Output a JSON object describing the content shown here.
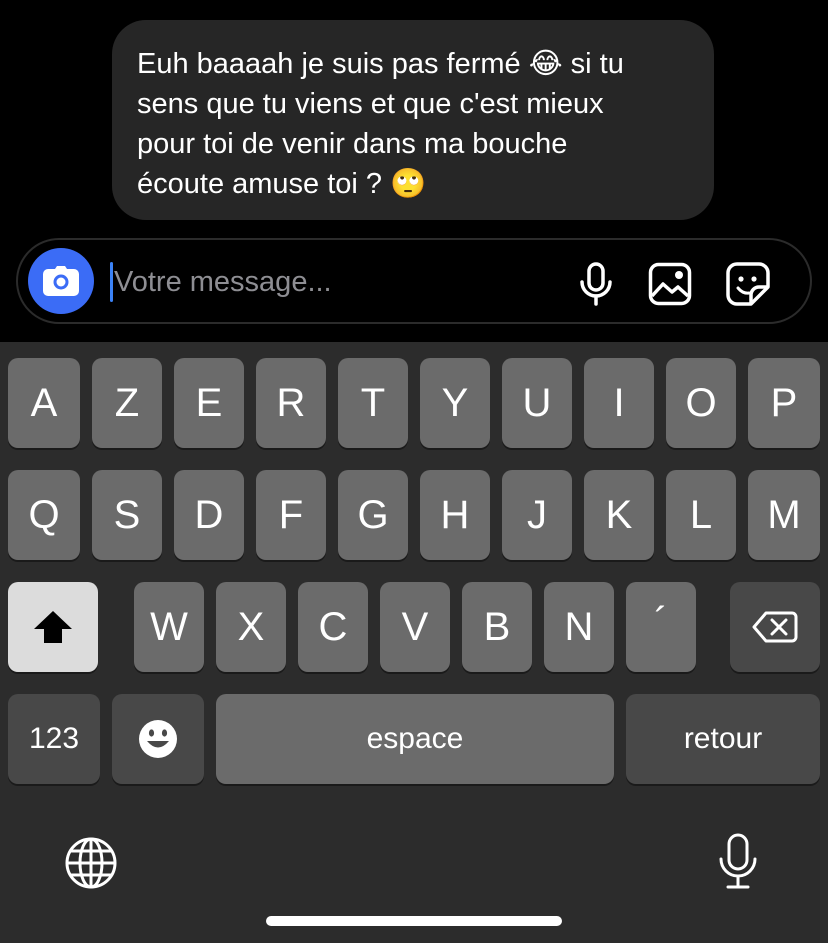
{
  "chat": {
    "message": "Euh baaaah je suis pas fermé 😂 si tu\nsens que tu viens et que c'est mieux\npour toi de venir dans ma bouche\nécoute amuse toi ? 🙄"
  },
  "composer": {
    "placeholder": "Votre message...",
    "icons": [
      "camera-icon",
      "microphone-icon",
      "image-icon",
      "sticker-icon"
    ],
    "camera_color": "#3b6cf6"
  },
  "keyboard": {
    "row1": [
      "A",
      "Z",
      "E",
      "R",
      "T",
      "Y",
      "U",
      "I",
      "O",
      "P"
    ],
    "row2": [
      "Q",
      "S",
      "D",
      "F",
      "G",
      "H",
      "J",
      "K",
      "L",
      "M"
    ],
    "row3": [
      "W",
      "X",
      "C",
      "V",
      "B",
      "N",
      "´"
    ],
    "numbers_label": "123",
    "space_label": "espace",
    "return_label": "retour",
    "icons": [
      "shift-icon",
      "backspace-icon",
      "emoji-icon",
      "globe-icon",
      "dictation-icon"
    ]
  }
}
